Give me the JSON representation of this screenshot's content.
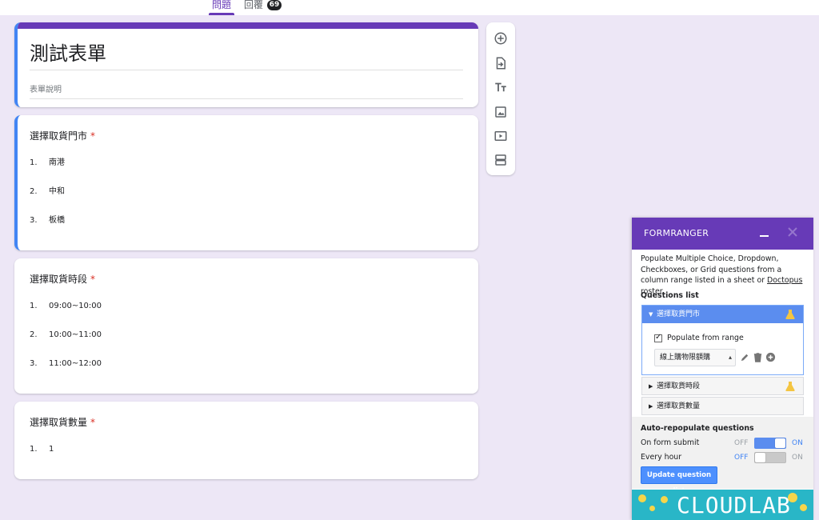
{
  "tabs": [
    {
      "label": "問題",
      "active": true
    },
    {
      "label": "回覆",
      "active": false
    }
  ],
  "response_count": "69",
  "form": {
    "title": "測試表單",
    "description": "表單說明"
  },
  "questions": [
    {
      "title": "選擇取貨門市",
      "required": "*",
      "options": [
        {
          "num": "1.",
          "label": "南港"
        },
        {
          "num": "2.",
          "label": "中和"
        },
        {
          "num": "3.",
          "label": "板橋"
        }
      ]
    },
    {
      "title": "選擇取貨時段",
      "required": "*",
      "options": [
        {
          "num": "1.",
          "label": "09:00~10:00"
        },
        {
          "num": "2.",
          "label": "10:00~11:00"
        },
        {
          "num": "3.",
          "label": "11:00~12:00"
        }
      ]
    },
    {
      "title": "選擇取貨數量",
      "required": "*",
      "options": [
        {
          "num": "1.",
          "label": "1"
        }
      ]
    }
  ],
  "toolbar": {
    "icons": [
      "add-question-icon",
      "import-questions-icon",
      "add-title-icon",
      "add-image-icon",
      "add-video-icon",
      "add-section-icon"
    ]
  },
  "formranger": {
    "title": "FORMRANGER",
    "description_before": "Populate Multiple Choice, Dropdown, Checkboxes, or Grid questions from a column range listed in a sheet or ",
    "description_link": "Doctopus",
    "description_after": " roster.",
    "questions_list_label": "Questions list",
    "questions": [
      {
        "label": "選擇取貨門市",
        "expanded": true
      },
      {
        "label": "選擇取貨時段",
        "expanded": false
      },
      {
        "label": "選擇取貨數量",
        "expanded": false
      }
    ],
    "populate_label": "Populate from range",
    "range_value": "線上購物限額購",
    "auto_label": "Auto-repopulate questions",
    "on_form_submit": {
      "label": "On form submit",
      "off": "OFF",
      "on": "ON",
      "state": "on"
    },
    "every_hour": {
      "label": "Every hour",
      "off": "OFF",
      "on": "ON",
      "state": "off"
    },
    "update_button": "Update question list",
    "banner": "CLOUDLAB",
    "colors": {
      "header": "#673ab7",
      "accent": "#4285f4",
      "banner": "#29b6c7"
    }
  }
}
